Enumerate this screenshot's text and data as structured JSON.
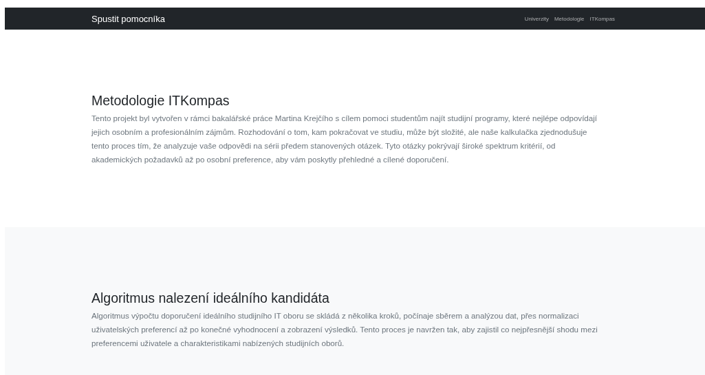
{
  "navbar": {
    "brand": "Spustit pomocníka",
    "links": [
      "Univerzity",
      "Metodologie",
      "ITKompas"
    ]
  },
  "sections": [
    {
      "kind": "plain",
      "title": "Metodologie ITKompas",
      "text": "Tento projekt byl vytvořen v rámci bakalářské práce Martina Krejčího s cílem pomoci studentům najít studijní programy, které nejlépe odpovídají jejich osobním a profesionálním zájmům. Rozhodování o tom, kam pokračovat ve studiu, může být složité, ale naše kalkulačka zjednodušuje tento proces tím, že analyzuje vaše odpovědi na sérii předem stanovených otázek. Tyto otázky pokrývají široké spektrum kritérií, od akademických požadavků až po osobní preference, aby vám poskytly přehledné a cílené doporučení."
    },
    {
      "kind": "shaded",
      "title": "Algoritmus nalezení ideálního kandidáta",
      "text": "Algoritmus výpočtu doporučení ideálního studijního IT oboru se skládá z několika kroků, počínaje sběrem a analýzou dat, přes normalizaci uživatelských preferencí až po konečné vyhodnocení a zobrazení výsledků. Tento proces je navržen tak, aby zajistil co nejpřesnější shodu mezi preferencemi uživatele a charakteristikami nabízených studijních oborů."
    }
  ]
}
